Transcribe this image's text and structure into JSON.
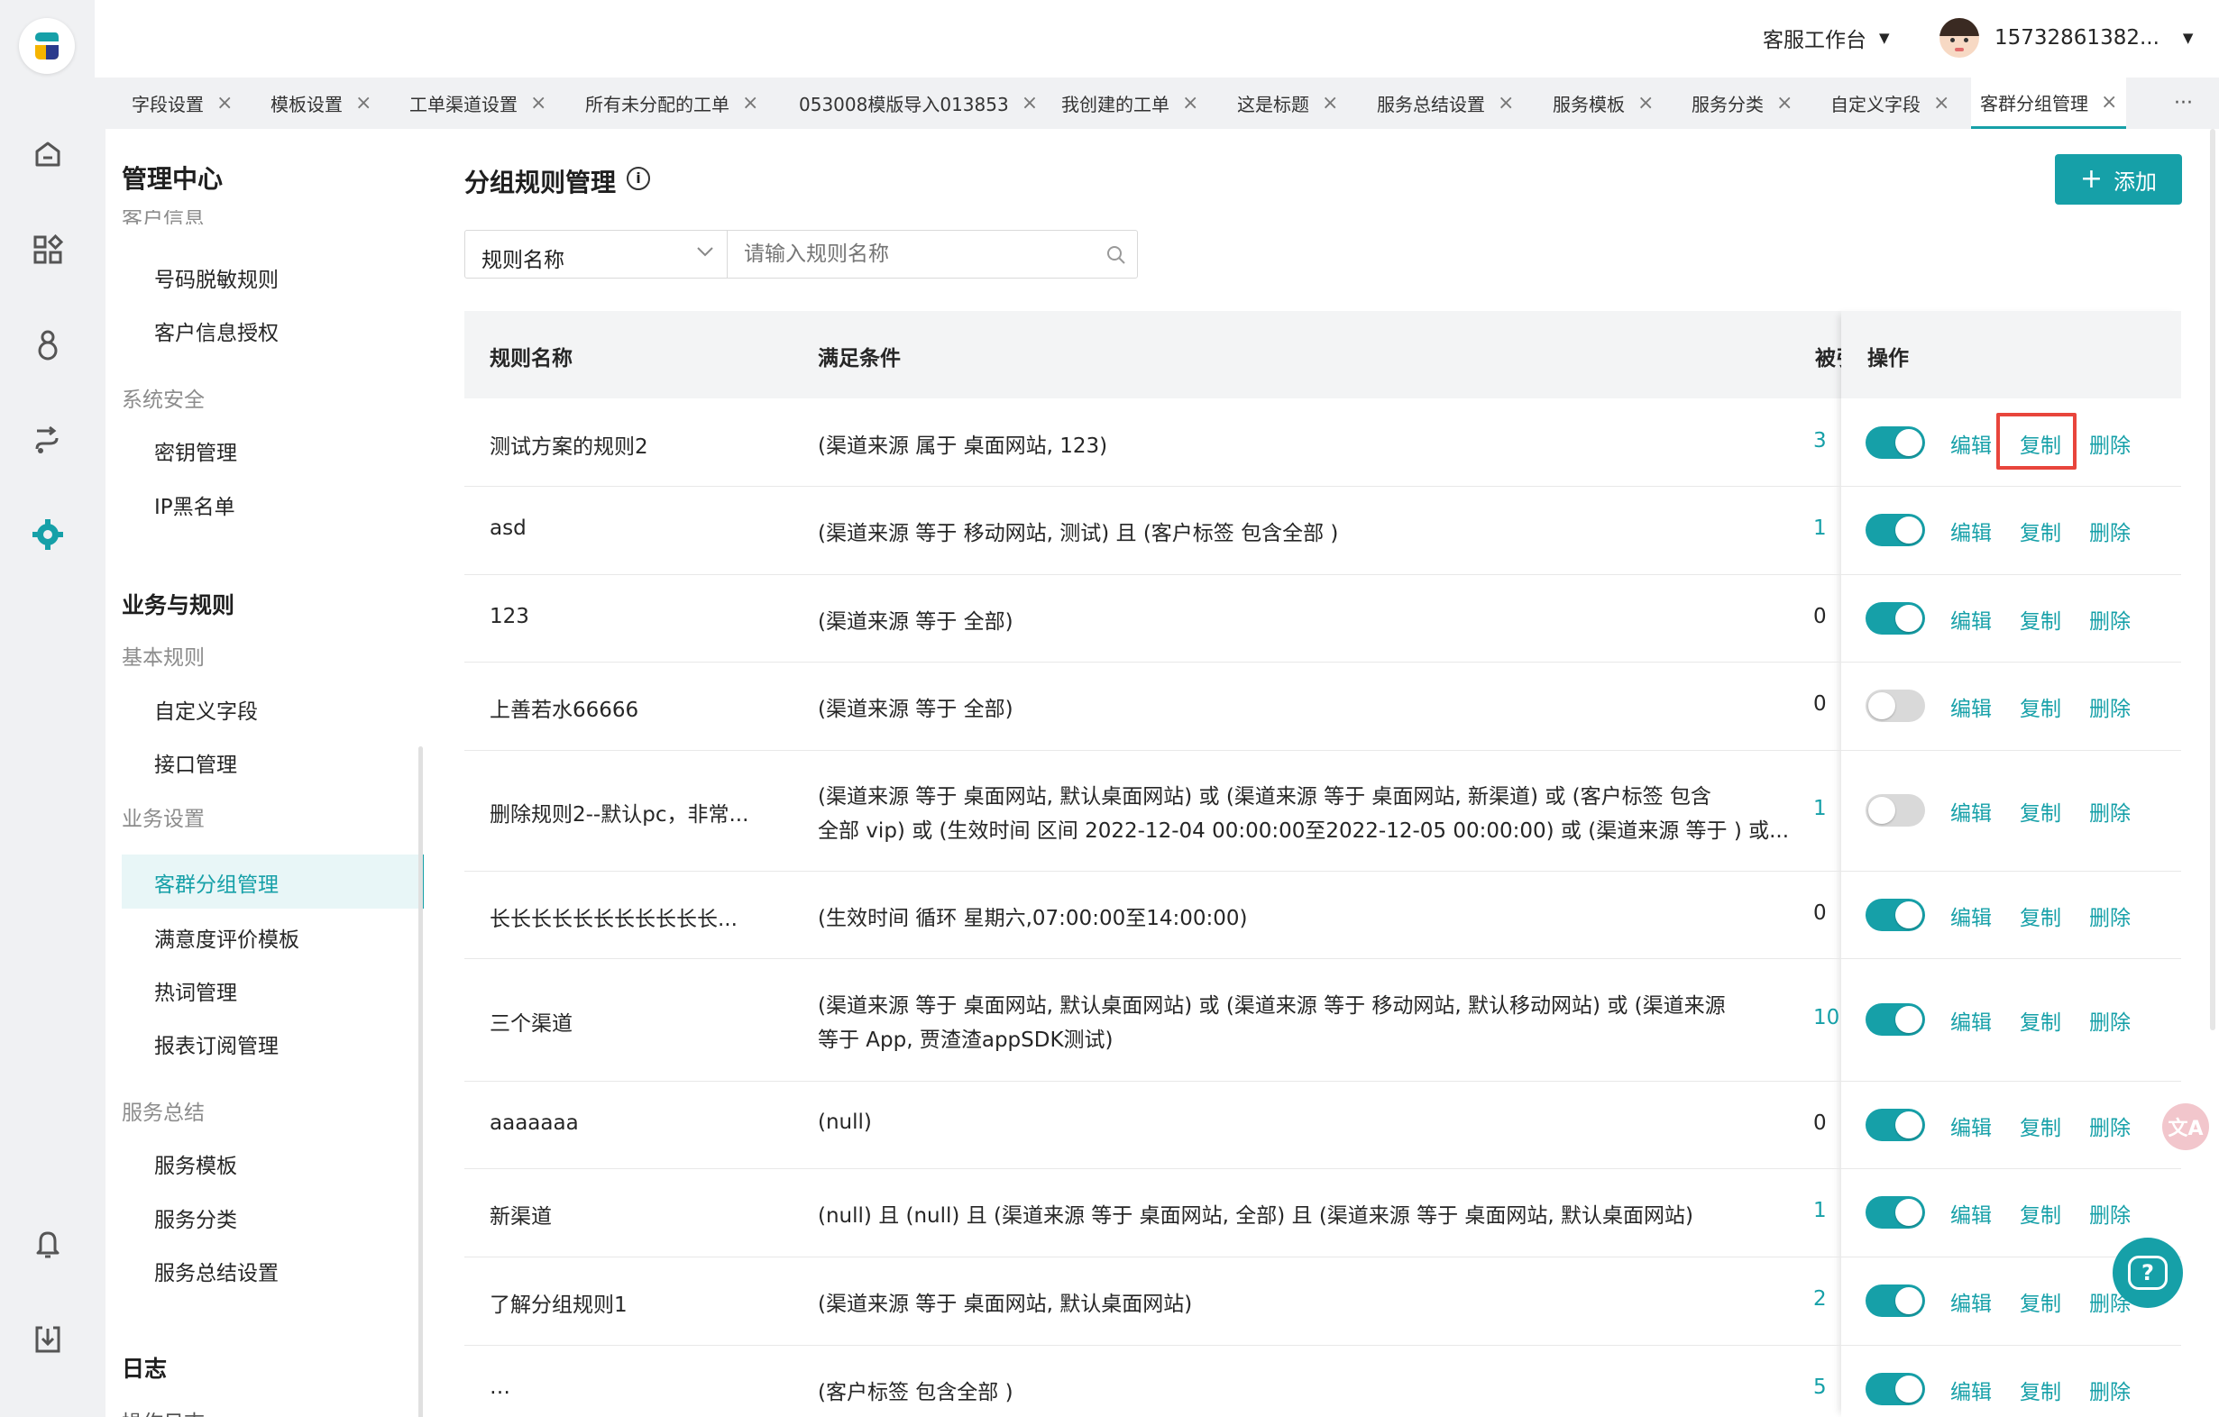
{
  "header": {
    "workspace": "客服工作台",
    "user": "15732861382..."
  },
  "tabs": [
    {
      "label": "字段设置"
    },
    {
      "label": "模板设置"
    },
    {
      "label": "工单渠道设置"
    },
    {
      "label": "所有未分配的工单"
    },
    {
      "label": "053008模版导入013853"
    },
    {
      "label": "我创建的工单"
    },
    {
      "label": "这是标题"
    },
    {
      "label": "服务总结设置"
    },
    {
      "label": "服务模板"
    },
    {
      "label": "服务分类"
    },
    {
      "label": "自定义字段"
    },
    {
      "label": "客群分组管理"
    }
  ],
  "tabs_more": "···",
  "sidebar": {
    "title": "管理中心",
    "cut_top": "客户信息",
    "items": [
      {
        "kind": "item",
        "label": "号码脱敏规则"
      },
      {
        "kind": "item",
        "label": "客户信息授权"
      },
      {
        "kind": "sub",
        "label": "系统安全"
      },
      {
        "kind": "item",
        "label": "密钥管理"
      },
      {
        "kind": "item",
        "label": "IP黑名单"
      },
      {
        "kind": "head",
        "label": "业务与规则"
      },
      {
        "kind": "sub",
        "label": "基本规则"
      },
      {
        "kind": "item",
        "label": "自定义字段"
      },
      {
        "kind": "item",
        "label": "接口管理"
      },
      {
        "kind": "sub",
        "label": "业务设置"
      },
      {
        "kind": "item",
        "label": "客群分组管理",
        "active": true
      },
      {
        "kind": "item",
        "label": "满意度评价模板"
      },
      {
        "kind": "item",
        "label": "热词管理"
      },
      {
        "kind": "item",
        "label": "报表订阅管理"
      },
      {
        "kind": "sub",
        "label": "服务总结"
      },
      {
        "kind": "item",
        "label": "服务模板"
      },
      {
        "kind": "item",
        "label": "服务分类"
      },
      {
        "kind": "item",
        "label": "服务总结设置"
      },
      {
        "kind": "head",
        "label": "日志"
      },
      {
        "kind": "item",
        "label": "操作日志"
      }
    ]
  },
  "page": {
    "title": "分组规则管理",
    "add_label": "添加"
  },
  "filter": {
    "select_value": "规则名称",
    "search_placeholder": "请输入规则名称"
  },
  "table": {
    "headers": {
      "name": "规则名称",
      "condition": "满足条件",
      "count": "被引",
      "ops": "操作"
    },
    "actions": {
      "edit": "编辑",
      "copy": "复制",
      "delete": "删除"
    },
    "rows": [
      {
        "name": "测试方案的规则2",
        "condition": [
          "(渠道来源 属于 桌面网站, 123)"
        ],
        "count": "3",
        "enabled": true
      },
      {
        "name": "asd",
        "condition": [
          "(渠道来源 等于 移动网站, 测试) 且 (客户标签 包含全部 )"
        ],
        "count": "1",
        "enabled": true
      },
      {
        "name": "123",
        "condition": [
          "(渠道来源 等于 全部)"
        ],
        "count": "0",
        "enabled": true
      },
      {
        "name": "上善若水66666",
        "condition": [
          "(渠道来源 等于 全部)"
        ],
        "count": "0",
        "enabled": false
      },
      {
        "name": "删除规则2--默认pc，非常...",
        "condition": [
          "(渠道来源 等于 桌面网站, 默认桌面网站) 或 (渠道来源 等于 桌面网站, 新渠道) 或 (客户标签 包含",
          "全部 vip) 或 (生效时间 区间 2022-12-04 00:00:00至2022-12-05 00:00:00) 或 (渠道来源 等于 ) 或..."
        ],
        "count": "1",
        "enabled": false
      },
      {
        "name": "长长长长长长长长长长长...",
        "condition": [
          "(生效时间 循环 星期六,07:00:00至14:00:00)"
        ],
        "count": "0",
        "enabled": true
      },
      {
        "name": "三个渠道",
        "condition": [
          "(渠道来源 等于 桌面网站, 默认桌面网站) 或 (渠道来源 等于 移动网站, 默认移动网站) 或 (渠道来源",
          "等于 App, 贾渣渣appSDK测试)"
        ],
        "count": "10",
        "enabled": true
      },
      {
        "name": "aaaaaaa",
        "condition": [
          "(null)"
        ],
        "count": "0",
        "enabled": true
      },
      {
        "name": "新渠道",
        "condition": [
          "(null) 且 (null) 且 (渠道来源 等于 桌面网站, 全部) 且 (渠道来源 等于 桌面网站, 默认桌面网站)"
        ],
        "count": "1",
        "enabled": true
      },
      {
        "name": "了解分组规则1",
        "condition": [
          "(渠道来源 等于 桌面网站, 默认桌面网站)"
        ],
        "count": "2",
        "enabled": true
      },
      {
        "name": "…",
        "condition": [
          "(客户标签 包含全部 )"
        ],
        "count": "5",
        "enabled": true
      }
    ]
  },
  "colors": {
    "accent": "#16a0a8",
    "toggle_off": "#d9d9d9",
    "highlight": "#e8453c"
  },
  "icons": [
    "home-icon",
    "apps-icon",
    "contacts-icon",
    "routing-icon",
    "settings-icon",
    "bell-icon",
    "download-icon",
    "info-icon",
    "search-icon",
    "chevron-down-icon",
    "translate-icon",
    "help-icon"
  ]
}
